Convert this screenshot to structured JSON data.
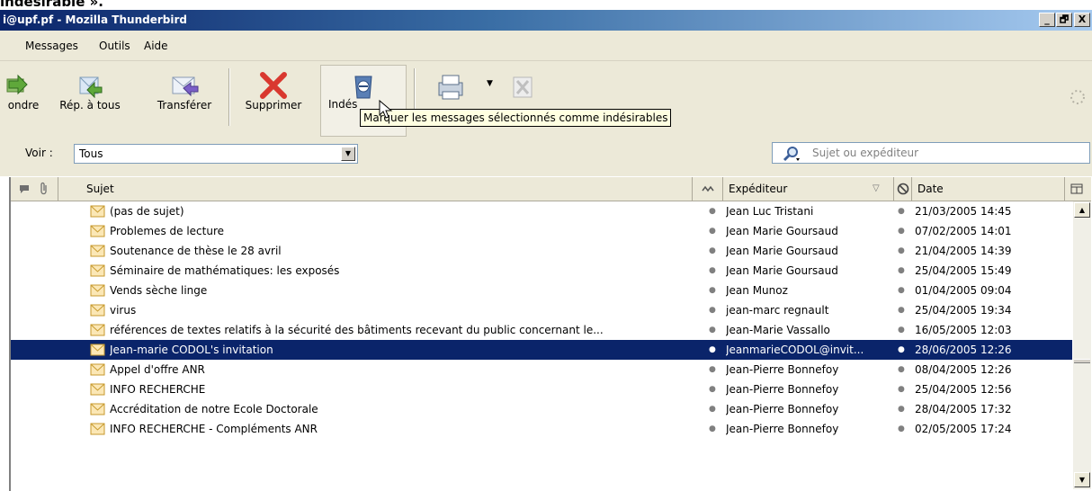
{
  "caption": "indésirable ».",
  "window": {
    "title": "i@upf.pf - Mozilla Thunderbird",
    "controls": [
      "_",
      "🗗",
      "X"
    ]
  },
  "menu": [
    "Messages",
    "Outils",
    "Aide"
  ],
  "toolbar": {
    "buttons": [
      {
        "label": "ondre",
        "icon": "reply-icon"
      },
      {
        "label": "Rép. à tous",
        "icon": "reply-all-icon"
      },
      {
        "label": "Transférer",
        "icon": "forward-icon"
      },
      {
        "label": "Supprimer",
        "icon": "delete-icon"
      },
      {
        "label": "Indés",
        "icon": "junk-icon"
      }
    ],
    "tooltip": "Marquer les messages sélectionnés comme indésirables"
  },
  "filter": {
    "view_label": "Voir :",
    "view_value": "Tous",
    "search_placeholder": "Sujet ou expéditeur"
  },
  "columns": {
    "subject": "Sujet",
    "sender": "Expéditeur",
    "date": "Date"
  },
  "messages": [
    {
      "subject": "(pas de sujet)",
      "sender": "Jean Luc Tristani",
      "date": "21/03/2005 14:45"
    },
    {
      "subject": "Problemes de lecture",
      "sender": "Jean Marie Goursaud",
      "date": "07/02/2005 14:01"
    },
    {
      "subject": "Soutenance de thèse le 28 avril",
      "sender": "Jean Marie Goursaud",
      "date": "21/04/2005 14:39"
    },
    {
      "subject": "Séminaire de mathématiques: les exposés",
      "sender": "Jean Marie Goursaud",
      "date": "25/04/2005 15:49"
    },
    {
      "subject": "Vends sèche linge",
      "sender": "Jean Munoz",
      "date": "01/04/2005 09:04"
    },
    {
      "subject": "virus",
      "sender": "jean-marc regnault",
      "date": "25/04/2005 19:34"
    },
    {
      "subject": "références de textes relatifs à la sécurité des bâtiments recevant du public concernant le...",
      "sender": "Jean-Marie Vassallo",
      "date": "16/05/2005 12:03"
    },
    {
      "subject": "Jean-marie CODOL's invitation",
      "sender": "JeanmarieCODOL@invit...",
      "date": "28/06/2005 12:26",
      "selected": true
    },
    {
      "subject": "Appel d'offre ANR",
      "sender": "Jean-Pierre Bonnefoy",
      "date": "08/04/2005 12:26"
    },
    {
      "subject": "INFO RECHERCHE",
      "sender": "Jean-Pierre Bonnefoy",
      "date": "25/04/2005 12:56"
    },
    {
      "subject": "Accréditation de notre Ecole Doctorale",
      "sender": "Jean-Pierre Bonnefoy",
      "date": "28/04/2005 17:32"
    },
    {
      "subject": "INFO RECHERCHE - Compléments ANR",
      "sender": "Jean-Pierre Bonnefoy",
      "date": "02/05/2005 17:24"
    }
  ]
}
